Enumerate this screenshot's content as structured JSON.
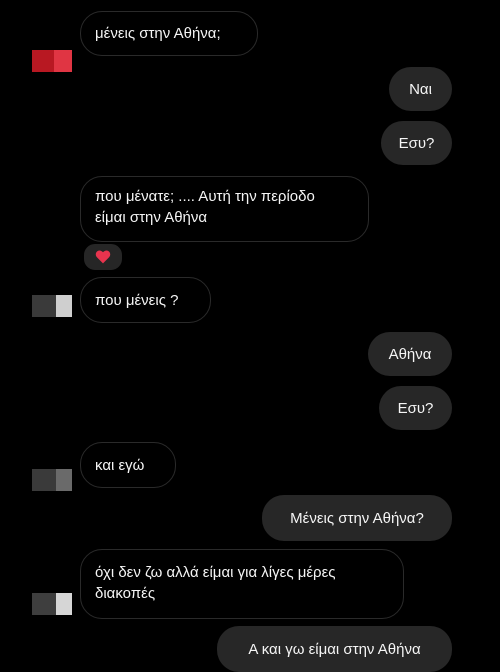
{
  "messages": [
    {
      "id": "m1",
      "side": "in",
      "text": "μένεις στην Αθήνα;"
    },
    {
      "id": "m2",
      "side": "out",
      "text": "Ναι"
    },
    {
      "id": "m3",
      "side": "out",
      "text": "Εσυ?"
    },
    {
      "id": "m4",
      "side": "in",
      "line1": "που μένατε; .... Αυτή την περίοδο",
      "line2": "είμαι στην Αθήνα",
      "reaction": "heart"
    },
    {
      "id": "m5",
      "side": "in",
      "text": "που μένεις ?"
    },
    {
      "id": "m6",
      "side": "out",
      "text": "Αθήνα"
    },
    {
      "id": "m7",
      "side": "out",
      "text": "Εσυ?"
    },
    {
      "id": "m8",
      "side": "in",
      "text": "και εγώ"
    },
    {
      "id": "m9",
      "side": "out",
      "text": "Μένεις στην Αθήνα?"
    },
    {
      "id": "m10",
      "side": "in",
      "line1": "όχι δεν ζω αλλά είμαι για λίγες μέρες",
      "line2": "διακοπές"
    },
    {
      "id": "m11",
      "side": "out",
      "text": "Α και γω είμαι στην Αθήνα"
    }
  ],
  "colors": {
    "background": "#000000",
    "incoming_border": "#2a2a2a",
    "outgoing_bubble": "#272727",
    "reaction_heart": "#e8344e"
  },
  "icons": {
    "reaction": "heart-icon",
    "avatar": "pixelated-avatar"
  }
}
